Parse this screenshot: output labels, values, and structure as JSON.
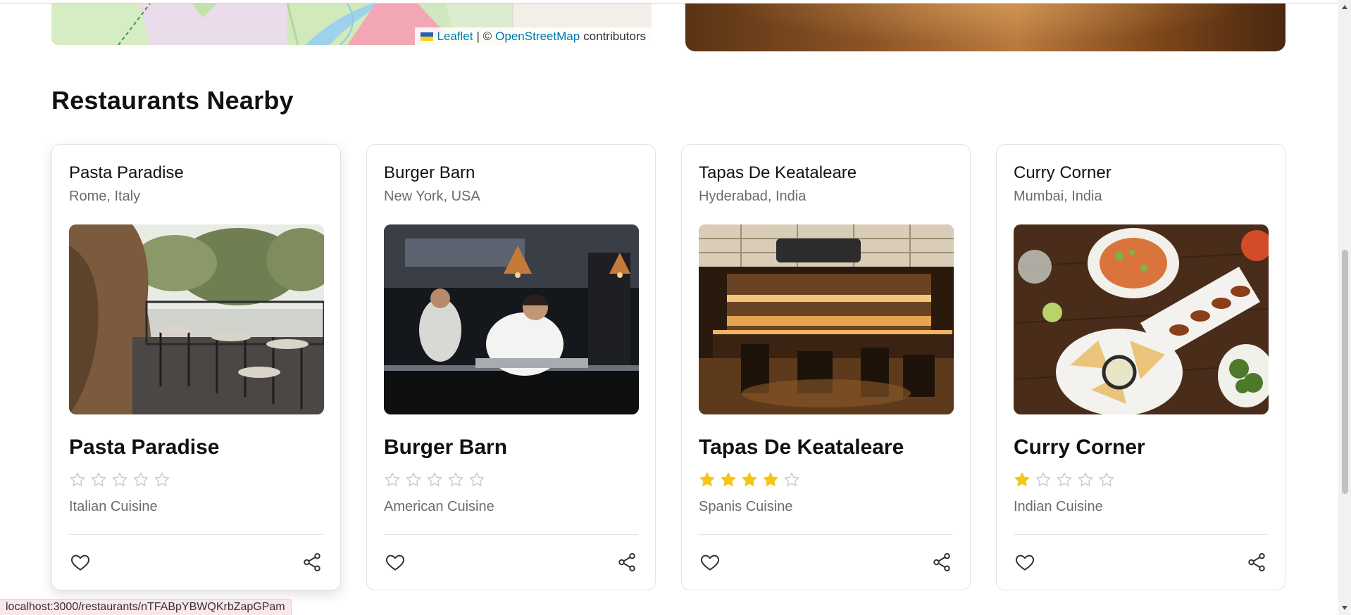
{
  "map": {
    "attribution_leaflet": "Leaflet",
    "attribution_sep": "| ©",
    "attribution_osm": "OpenStreetMap",
    "attribution_tail": "contributors"
  },
  "section_title": "Restaurants Nearby",
  "star_color_filled": "#f5c518",
  "star_color_empty": "#c9c9c9",
  "restaurants": [
    {
      "header_name": "Pasta Paradise",
      "location": "Rome, Italy",
      "title": "Pasta Paradise",
      "rating": 0,
      "cuisine": "Italian Cuisine",
      "photo": "outdoor-terrace-photo"
    },
    {
      "header_name": "Burger Barn",
      "location": "New York, USA",
      "title": "Burger Barn",
      "rating": 0,
      "cuisine": "American Cuisine",
      "photo": "chef-kitchen-photo"
    },
    {
      "header_name": "Tapas De Keataleare",
      "location": "Hyderabad, India",
      "title": "Tapas De Keataleare",
      "rating": 4,
      "cuisine": "Spanis Cuisine",
      "photo": "bar-interior-photo"
    },
    {
      "header_name": "Curry Corner",
      "location": "Mumbai, India",
      "title": "Curry Corner",
      "rating": 1,
      "cuisine": "Indian Cuisine",
      "photo": "food-spread-photo"
    }
  ],
  "status_bar": {
    "url": "localhost:3000/restaurants/nTFABpYBWQKrbZapGPam"
  }
}
